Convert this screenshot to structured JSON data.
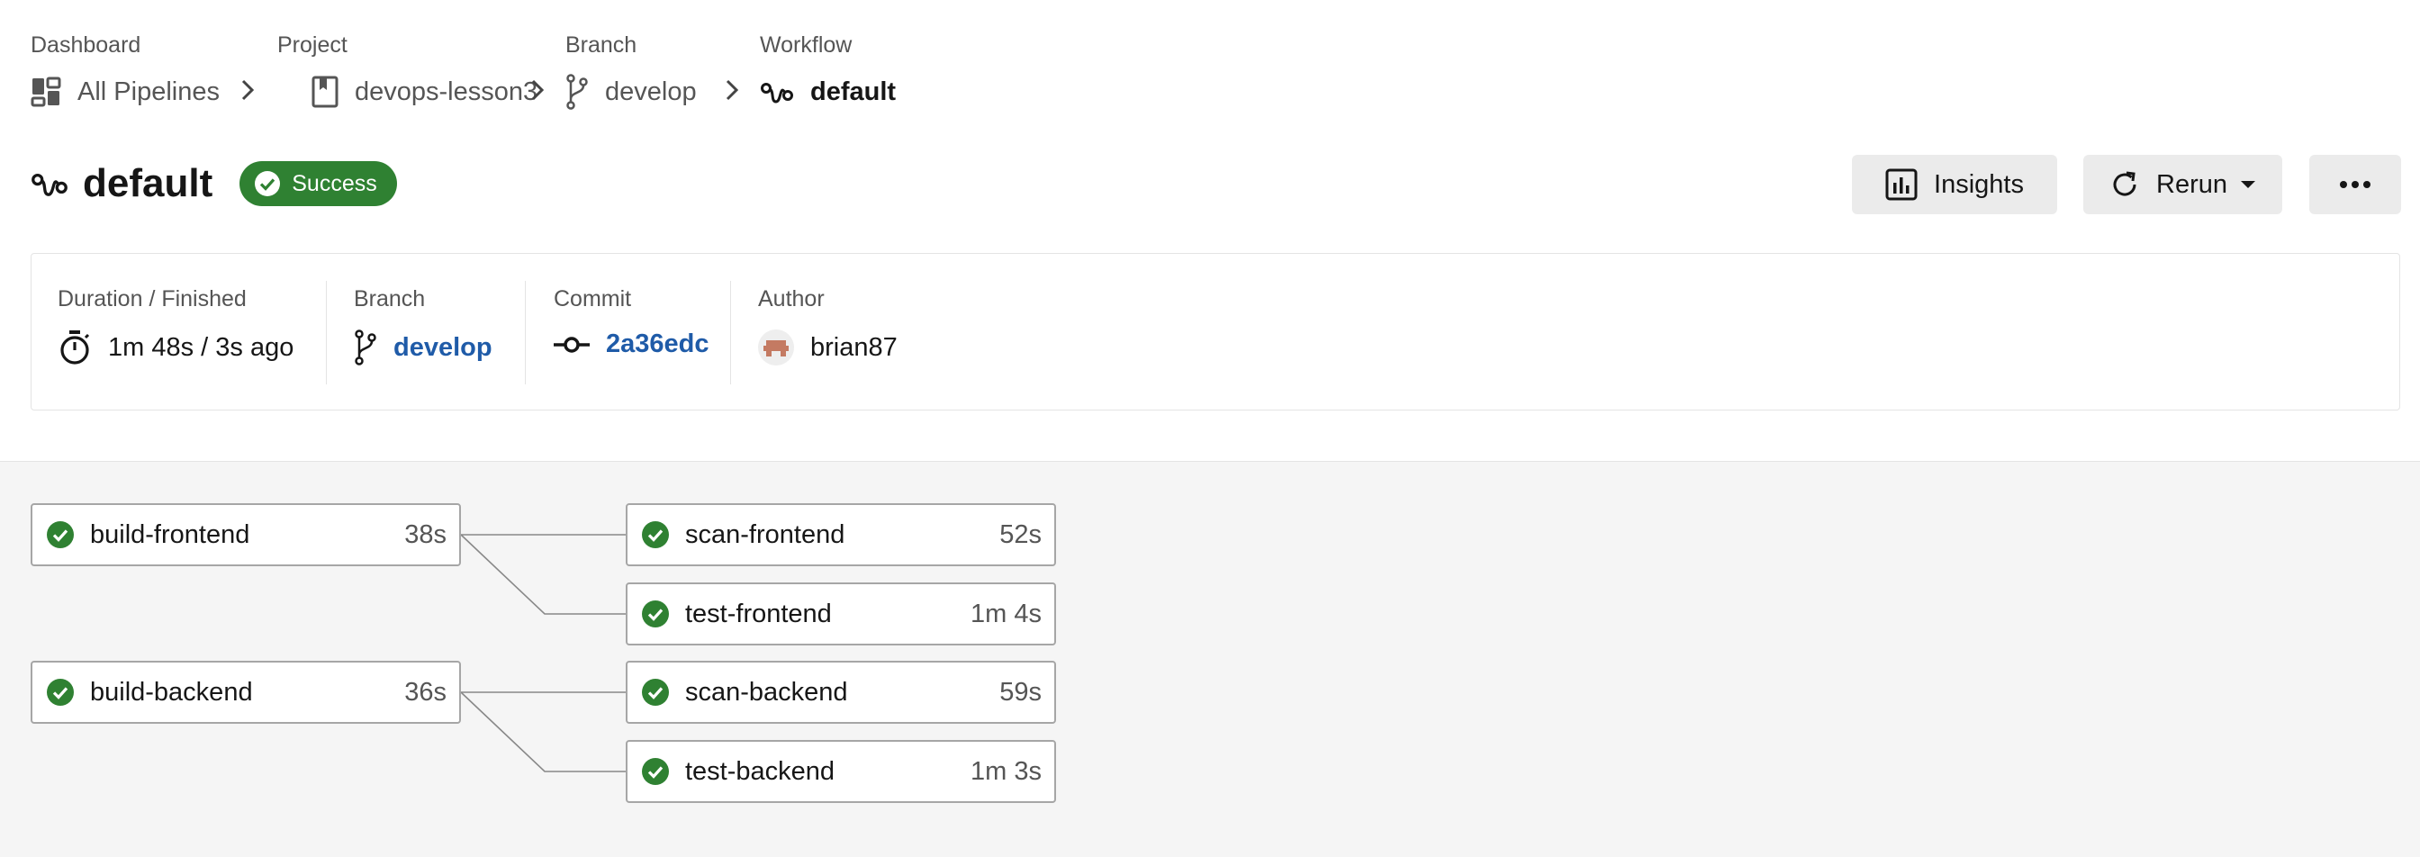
{
  "breadcrumb": {
    "dashboard": {
      "label": "Dashboard",
      "value": "All Pipelines",
      "icon": "dashboard-icon"
    },
    "project": {
      "label": "Project",
      "value": "devops-lesson3",
      "icon": "bookmark-icon"
    },
    "branch": {
      "label": "Branch",
      "value": "develop",
      "icon": "branch-icon"
    },
    "workflow": {
      "label": "Workflow",
      "value": "default",
      "icon": "workflow-icon"
    }
  },
  "header": {
    "title": "default",
    "status": "Success",
    "insights_label": "Insights",
    "rerun_label": "Rerun",
    "more_label": "more"
  },
  "summary": {
    "duration": {
      "label": "Duration / Finished",
      "value": "1m 48s / 3s ago"
    },
    "branch": {
      "label": "Branch",
      "value": "develop"
    },
    "commit": {
      "label": "Commit",
      "value": "2a36edc"
    },
    "author": {
      "label": "Author",
      "value": "brian87"
    }
  },
  "jobs": [
    {
      "name": "build-frontend",
      "duration": "38s",
      "status": "success"
    },
    {
      "name": "scan-frontend",
      "duration": "52s",
      "status": "success"
    },
    {
      "name": "test-frontend",
      "duration": "1m 4s",
      "status": "success"
    },
    {
      "name": "build-backend",
      "duration": "36s",
      "status": "success"
    },
    {
      "name": "scan-backend",
      "duration": "59s",
      "status": "success"
    },
    {
      "name": "test-backend",
      "duration": "1m 3s",
      "status": "success"
    }
  ],
  "colors": {
    "success": "#2f8132",
    "link": "#1f5ba8",
    "button_bg": "#ebebeb",
    "workflow_bg": "#f5f5f5"
  }
}
